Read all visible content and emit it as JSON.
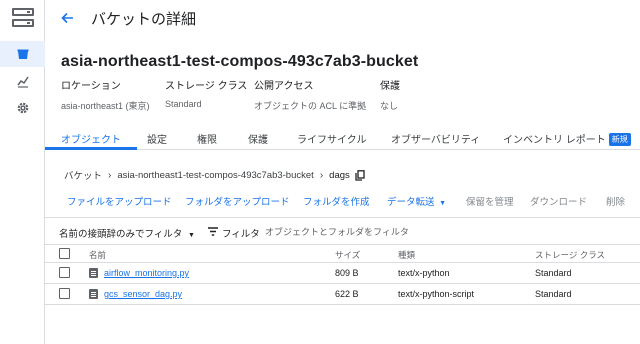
{
  "header": {
    "title": "バケットの詳細"
  },
  "bucket": {
    "name": "asia-northeast1-test-compos-493c7ab3-bucket"
  },
  "meta": [
    {
      "label": "ロケーション",
      "value": "asia-northeast1 (東京)"
    },
    {
      "label": "ストレージ クラス",
      "value": "Standard"
    },
    {
      "label": "公開アクセス",
      "value": "オブジェクトの ACL に準拠"
    },
    {
      "label": "保護",
      "value": "なし"
    }
  ],
  "tabs": [
    {
      "label": "オブジェクト"
    },
    {
      "label": "設定"
    },
    {
      "label": "権限"
    },
    {
      "label": "保護"
    },
    {
      "label": "ライフサイクル"
    },
    {
      "label": "オブザーバビリティ"
    },
    {
      "label": "インベントリ レポート",
      "badge": "新規"
    }
  ],
  "breadcrumb": {
    "root": "バケット",
    "bucket": "asia-northeast1-test-compos-493c7ab3-bucket",
    "folder": "dags"
  },
  "actions": {
    "upload_files": "ファイルをアップロード",
    "upload_folder": "フォルダをアップロード",
    "create_folder": "フォルダを作成",
    "transfer": "データ転送",
    "manage_holds": "保留を管理",
    "download": "ダウンロード",
    "delete": "削除"
  },
  "filter": {
    "prefix_label": "名前の接頭辞のみでフィルタ",
    "label": "フィルタ",
    "placeholder": "オブジェクトとフォルダをフィルタ"
  },
  "table": {
    "columns": [
      "名前",
      "サイズ",
      "種類",
      "ストレージ クラス"
    ],
    "rows": [
      {
        "name": "airflow_monitoring.py",
        "size": "809 B",
        "type": "text/x-python",
        "storage_class": "Standard"
      },
      {
        "name": "gcs_sensor_dag.py",
        "size": "622 B",
        "type": "text/x-python-script",
        "storage_class": "Standard"
      }
    ]
  },
  "colors": {
    "accent": "#1a73e8",
    "text": "#202124",
    "muted": "#5f6368",
    "border": "#dadce0"
  }
}
